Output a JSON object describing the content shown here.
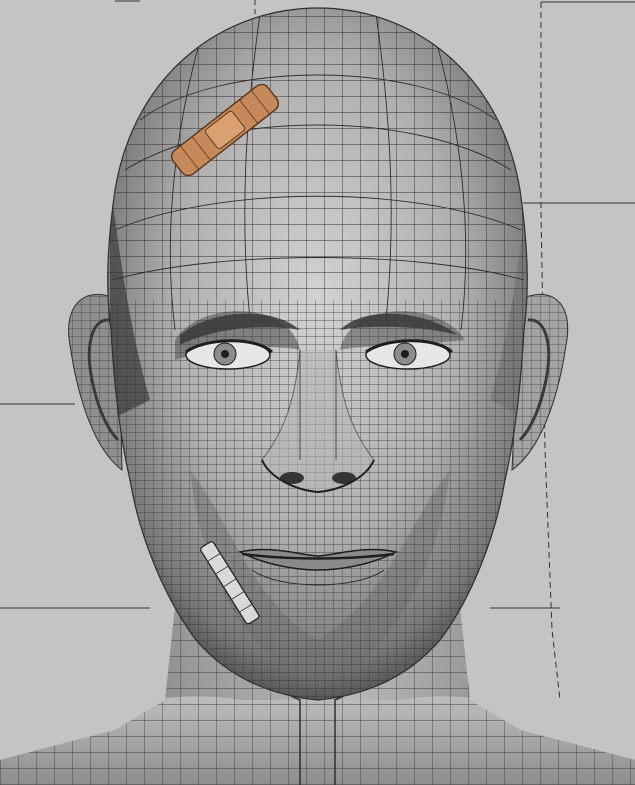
{
  "scene": {
    "subject": "wireframe-head",
    "colors": {
      "background": "#c4c4c4",
      "skin_light": "#cfcfcf",
      "skin_mid": "#a8a8a8",
      "skin_dark": "#4a4a4a",
      "wire": "#2e2e2e",
      "bandage": "#c8895a",
      "cigarette": "#d9d9d9",
      "guide_line": "#333333"
    }
  }
}
